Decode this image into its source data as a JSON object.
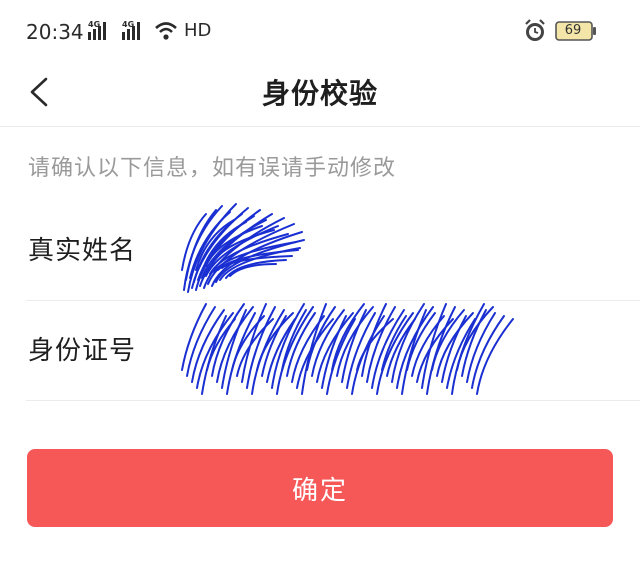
{
  "status_bar": {
    "time": "20:34",
    "network_label": "HD",
    "battery_level": "69",
    "icons": [
      "4g-signal-icon",
      "4g-signal-icon",
      "wifi-icon",
      "hd-icon",
      "alarm-icon",
      "battery-icon"
    ]
  },
  "nav": {
    "title": "身份校验",
    "back_icon": "chevron-left-icon"
  },
  "hint": "请确认以下信息，如有误请手动修改",
  "form": {
    "name_label": "真实姓名",
    "id_label": "身份证号"
  },
  "confirm_button": {
    "label": "确定"
  },
  "colors": {
    "accent": "#f65757",
    "scribble": "#1a2fd1",
    "hint_text": "#9a9a9a",
    "divider": "#ececec"
  }
}
